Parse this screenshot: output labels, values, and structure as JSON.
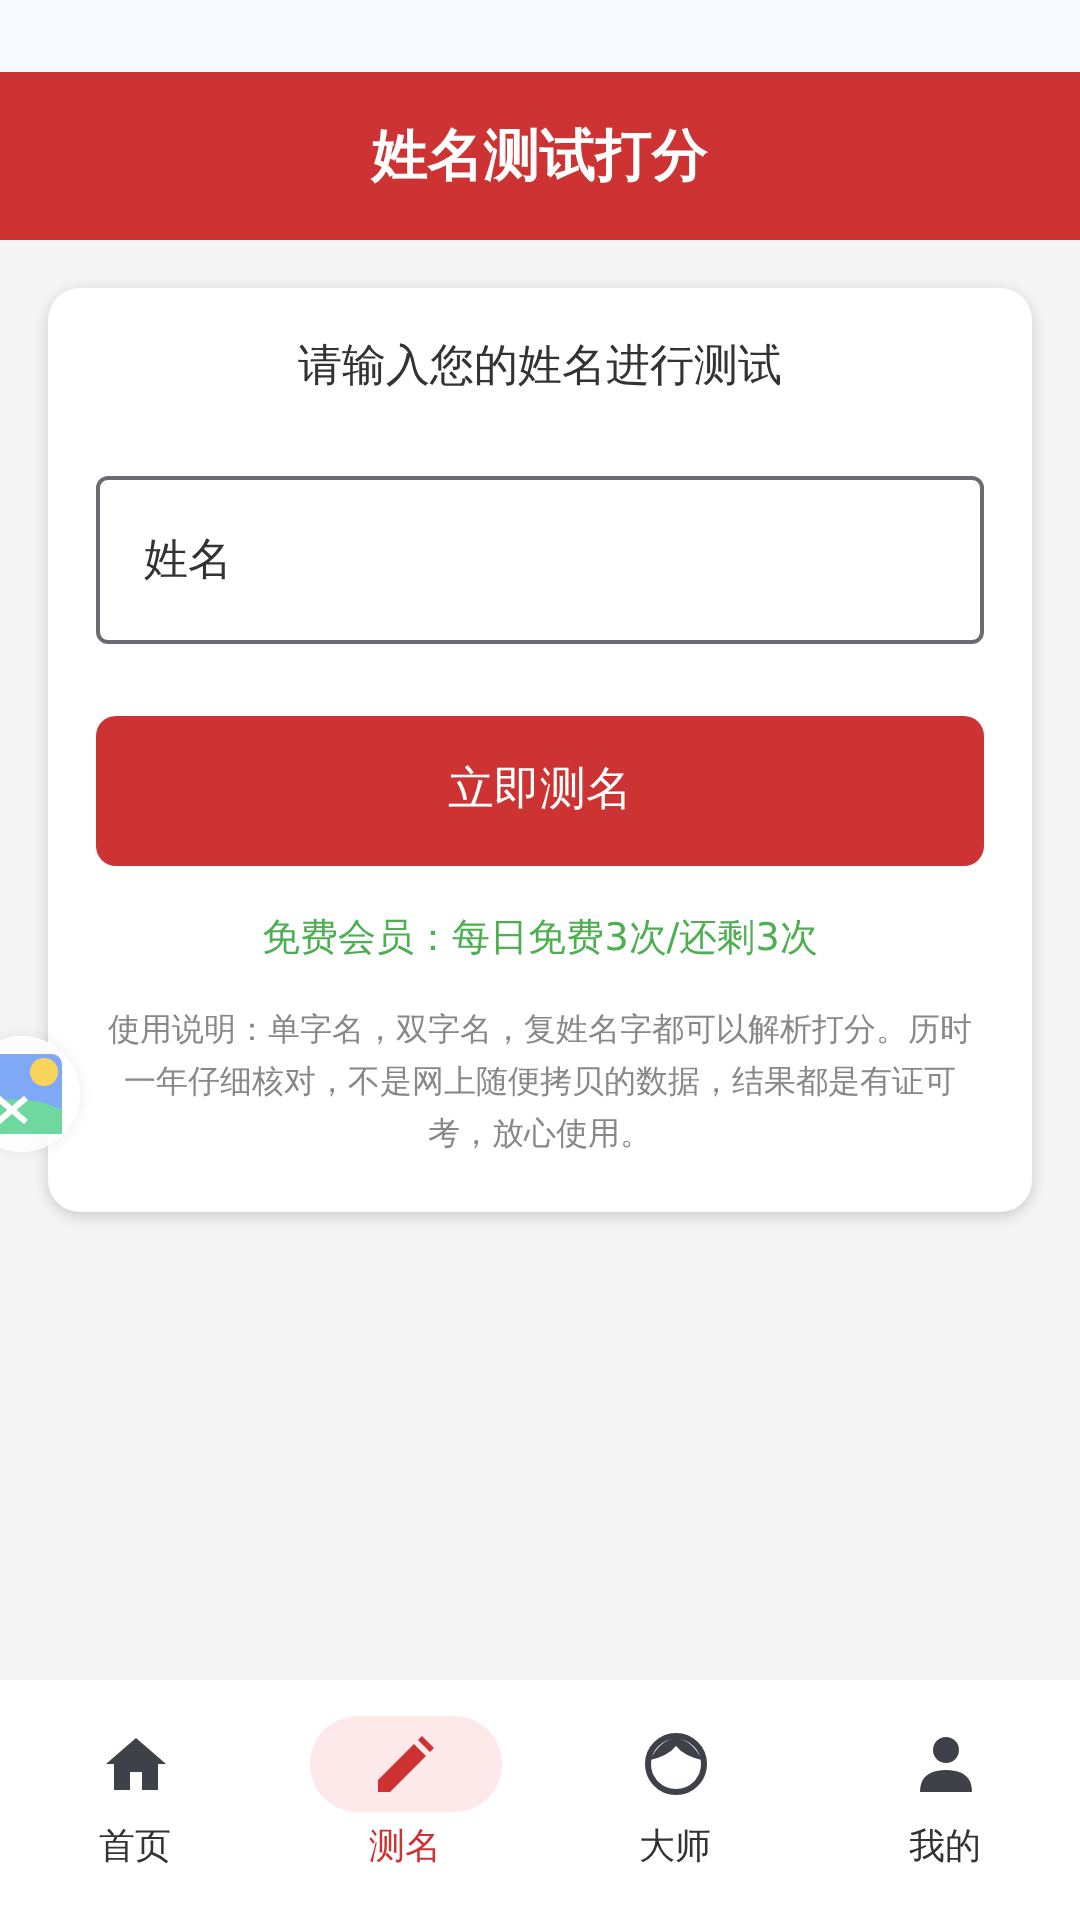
{
  "header": {
    "title": "姓名测试打分"
  },
  "card": {
    "prompt": "请输入您的姓名进行测试",
    "name_field": {
      "placeholder": "姓名"
    },
    "submit_button": "立即测名",
    "quota": "免费会员：每日免费3次/还剩3次",
    "instructions": "使用说明：单字名，双字名，复姓名字都可以解析打分。历时一年仔细核对，不是网上随便拷贝的数据，结果都是有证可考，放心使用。"
  },
  "tab_bar": [
    {
      "label": "首页",
      "selected": false
    },
    {
      "label": "测名",
      "selected": true
    },
    {
      "label": "大师",
      "selected": false
    },
    {
      "label": "我的",
      "selected": false
    }
  ]
}
